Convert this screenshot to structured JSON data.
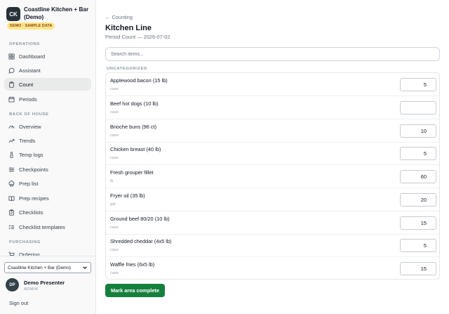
{
  "brand": {
    "logo_text": "CK",
    "name": "Coastline Kitchen + Bar (Demo)",
    "badge": "DEMO · SAMPLE DATA"
  },
  "sidebar": {
    "sections": [
      {
        "label": "OPERATIONS",
        "items": [
          {
            "label": "Dashboard",
            "icon": "grid-icon",
            "active": false
          },
          {
            "label": "Assistant",
            "icon": "chat-bubble-icon",
            "active": false
          },
          {
            "label": "Count",
            "icon": "clipboard-icon",
            "active": true
          },
          {
            "label": "Periods",
            "icon": "calendar-icon",
            "active": false
          }
        ]
      },
      {
        "label": "BACK OF HOUSE",
        "items": [
          {
            "label": "Overview",
            "icon": "gauge-icon",
            "active": false
          },
          {
            "label": "Trends",
            "icon": "trend-up-icon",
            "active": false
          },
          {
            "label": "Temp logs",
            "icon": "thermometer-icon",
            "active": false
          },
          {
            "label": "Checkpoints",
            "icon": "sliders-icon",
            "active": false
          },
          {
            "label": "Prep list",
            "icon": "chef-hat-icon",
            "active": false
          },
          {
            "label": "Prep recipes",
            "icon": "book-icon",
            "active": false
          },
          {
            "label": "Checklists",
            "icon": "clipboard-check-icon",
            "active": false
          },
          {
            "label": "Checklist templates",
            "icon": "list-check-icon",
            "active": false
          }
        ]
      },
      {
        "label": "PURCHASING",
        "items": [
          {
            "label": "Ordering",
            "icon": "cart-icon",
            "active": false
          }
        ]
      }
    ],
    "location_select": "Coastline Kitchen + Bar (Demo)",
    "user": {
      "initials": "DP",
      "name": "Demo Presenter",
      "role": "ADMIN"
    },
    "signout": "Sign out"
  },
  "main": {
    "back_link": "← Counting",
    "title": "Kitchen Line",
    "subtitle": "Period Count — 2026-07-02",
    "search_placeholder": "Search items...",
    "category": "UNCATEGORIZED",
    "items": [
      {
        "name": "Applewood bacon (15 lb)",
        "unit": "case",
        "value": "5"
      },
      {
        "name": "Beef hot dogs (10 lb)",
        "unit": "case",
        "value": ""
      },
      {
        "name": "Brioche buns (96 ct)",
        "unit": "case",
        "value": "10"
      },
      {
        "name": "Chicken breast (40 lb)",
        "unit": "case",
        "value": "5"
      },
      {
        "name": "Fresh grouper fillet",
        "unit": "lb",
        "value": "60"
      },
      {
        "name": "Fryer oil (35 lb)",
        "unit": "gal",
        "value": "20"
      },
      {
        "name": "Ground beef 80/20 (10 lb)",
        "unit": "case",
        "value": "15"
      },
      {
        "name": "Shredded cheddar (4x5 lb)",
        "unit": "case",
        "value": "5"
      },
      {
        "name": "Waffle fries (6x5 lb)",
        "unit": "case",
        "value": "15"
      }
    ],
    "complete_button": "Mark area complete"
  },
  "colors": {
    "accent": "#15803d",
    "badge_bg": "#fde68a",
    "logo_bg": "#273238"
  }
}
